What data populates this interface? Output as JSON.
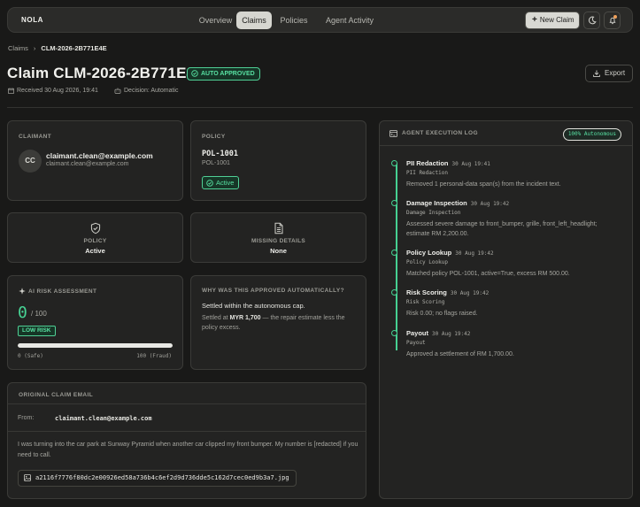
{
  "app": {
    "brand": "NOLA"
  },
  "nav": {
    "tabs": [
      "Overview",
      "Claims",
      "Policies",
      "Agent Activity"
    ],
    "active": "Claims",
    "new_claim": "New Claim"
  },
  "breadcrumb": {
    "root": "Claims",
    "current": "CLM-2026-2B771E4E"
  },
  "claim": {
    "title": "Claim CLM-2026-2B771E4E",
    "status": "AUTO APPROVED",
    "received": "Received 30 Aug 2026, 19:41",
    "decision": "Decision: Automatic",
    "export": "Export"
  },
  "claimant": {
    "label": "CLAIMANT",
    "initials": "CC",
    "email": "claimant.clean@example.com",
    "sub": "claimant.clean@example.com"
  },
  "policy": {
    "label": "POLICY",
    "number": "POL-1001",
    "sub": "POL-1001",
    "status": "Active"
  },
  "stats": [
    {
      "label": "POLICY",
      "value": "Active",
      "icon": "shield-check-icon"
    },
    {
      "label": "MISSING DETAILS",
      "value": "None",
      "icon": "document-icon"
    }
  ],
  "risk": {
    "label": "AI RISK ASSESSMENT",
    "score": "0",
    "max": "/ 100",
    "score_fraction": 0.0,
    "level": "LOW RISK",
    "min_label": "0 (Safe)",
    "max_label": "100 (Fraud)"
  },
  "why": {
    "label": "WHY WAS THIS APPROVED AUTOMATICALLY?",
    "main": "Settled within the autonomous cap.",
    "sub_prefix": "Settled at ",
    "amount": "MYR 1,700",
    "sub_suffix": " — the repair estimate less the policy excess."
  },
  "email": {
    "label": "ORIGINAL CLAIM EMAIL",
    "from_label": "From:",
    "from": "claimant.clean@example.com",
    "body": "I was turning into the car park at Sunway Pyramid when another car clipped my front bumper. My number is [redacted] if you need to call.",
    "attachment": "a2116f7776f80dc2e00926ed58a736b4c6ef2d9d736dde5c162d7cec0ed9b3a7.jpg"
  },
  "log": {
    "label": "AGENT EXECUTION LOG",
    "badge": "100% Autonomous",
    "events": [
      {
        "title": "PII Redaction",
        "time": "30 Aug 19:41",
        "code": "PII Redaction",
        "desc": "Removed 1 personal-data span(s) from the incident text."
      },
      {
        "title": "Damage Inspection",
        "time": "30 Aug 19:42",
        "code": "Damage Inspection",
        "desc": "Assessed severe damage to front_bumper, grille, front_left_headlight; estimate RM 2,200.00."
      },
      {
        "title": "Policy Lookup",
        "time": "30 Aug 19:42",
        "code": "Policy Lookup",
        "desc": "Matched policy POL-1001, active=True, excess RM 500.00."
      },
      {
        "title": "Risk Scoring",
        "time": "30 Aug 19:42",
        "code": "Risk Scoring",
        "desc": "Risk 0.00; no flags raised."
      },
      {
        "title": "Payout",
        "time": "30 Aug 19:42",
        "code": "Payout",
        "desc": "Approved a settlement of RM 1,700.00."
      }
    ]
  },
  "colors": {
    "accent": "#46d092",
    "background": "#191918",
    "card": "#232322"
  }
}
